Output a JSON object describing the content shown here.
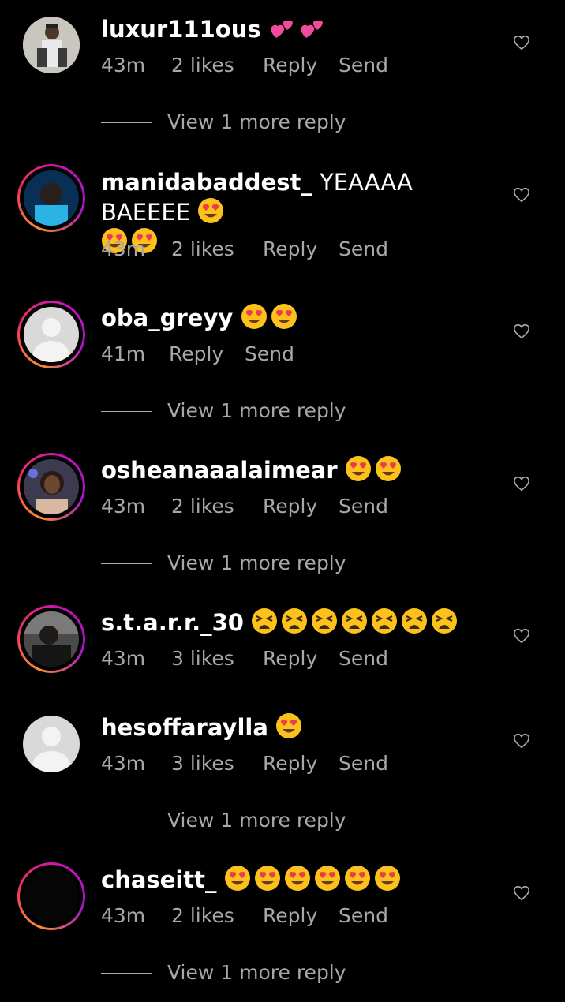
{
  "colors": {
    "background": "#000000",
    "text": "#ffffff",
    "secondary_text": "#a8a8a8",
    "story_ring_start": "#fd8d32",
    "story_ring_end": "#c913b9"
  },
  "comments": [
    {
      "username": "luxur111ous",
      "text": "",
      "emojis": [
        "two-hearts",
        "two-hearts"
      ],
      "time": "43m",
      "likes": "2 likes",
      "reply": "Reply",
      "send": "Send",
      "view_more": "View 1 more reply",
      "avatar": "photo-square"
    },
    {
      "username": "manidabaddest_",
      "text": "YEAAAA BAEEEE",
      "emojis": [
        "heart-eyes",
        "heart-eyes",
        "heart-eyes"
      ],
      "time": "43m",
      "likes": "2 likes",
      "reply": "Reply",
      "send": "Send",
      "view_more": "",
      "avatar": "story-ring"
    },
    {
      "username": "oba_greyy",
      "text": "",
      "emojis": [
        "heart-eyes",
        "heart-eyes"
      ],
      "time": "41m",
      "likes": "",
      "reply": "Reply",
      "send": "Send",
      "view_more": "View 1 more reply",
      "avatar": "story-ring-default"
    },
    {
      "username": "osheanaaalaimear",
      "text": "",
      "emojis": [
        "heart-eyes",
        "heart-eyes"
      ],
      "time": "43m",
      "likes": "2 likes",
      "reply": "Reply",
      "send": "Send",
      "view_more": "View 1 more reply",
      "avatar": "story-ring"
    },
    {
      "username": "s.t.a.r.r._30",
      "text": "",
      "emojis": [
        "tired-face",
        "tired-face",
        "tired-face",
        "tired-face",
        "tired-face",
        "tired-face",
        "tired-face"
      ],
      "time": "43m",
      "likes": "3 likes",
      "reply": "Reply",
      "send": "Send",
      "view_more": "",
      "avatar": "story-ring"
    },
    {
      "username": "hesoffaraylla",
      "text": "",
      "emojis": [
        "heart-eyes"
      ],
      "time": "43m",
      "likes": "3 likes",
      "reply": "Reply",
      "send": "Send",
      "view_more": "View 1 more reply",
      "avatar": "default"
    },
    {
      "username": "chaseitt_",
      "text": "",
      "emojis": [
        "heart-eyes",
        "heart-eyes",
        "heart-eyes",
        "heart-eyes",
        "heart-eyes",
        "heart-eyes"
      ],
      "time": "43m",
      "likes": "2 likes",
      "reply": "Reply",
      "send": "Send",
      "view_more": "View 1 more reply",
      "avatar": "story-ring-dark"
    }
  ],
  "icons": {
    "like": "heart-outline-icon"
  }
}
